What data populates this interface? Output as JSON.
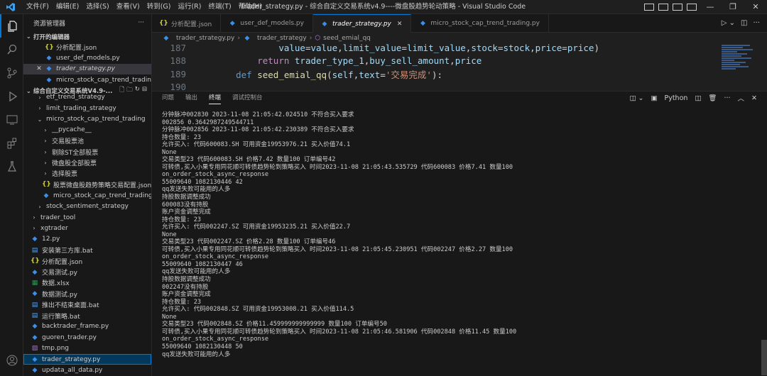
{
  "menu": [
    "文件(F)",
    "编辑(E)",
    "选择(S)",
    "查看(V)",
    "转到(G)",
    "运行(R)",
    "终端(T)",
    "帮助(H)"
  ],
  "window_title": "trader_strategy.py - 综合自定义交易系统v4.9----微盘股趋势轮动策略 - Visual Studio Code",
  "sidebar": {
    "title": "资源管理器",
    "open_editors_label": "打开的编辑器",
    "open_editors": [
      {
        "name": "分析配置.json",
        "icon": "json"
      },
      {
        "name": "user_def_models.py",
        "icon": "py"
      },
      {
        "name": "trader_strategy.py",
        "icon": "py"
      },
      {
        "name": "micro_stock_cap_trend_trading....",
        "icon": "py"
      }
    ],
    "workspace_label": "综合自定义交易系统V4.9-...",
    "tree": [
      {
        "name": "etf_trend_strategy",
        "indent": 1,
        "chev": "›"
      },
      {
        "name": "limit_trading_strategy",
        "indent": 1,
        "chev": "›"
      },
      {
        "name": "micro_stock_cap_trend_trading",
        "indent": 1,
        "chev": "⌄"
      },
      {
        "name": "__pycache__",
        "indent": 2,
        "chev": "›"
      },
      {
        "name": "交易股票池",
        "indent": 2,
        "chev": "›"
      },
      {
        "name": "剔除ST全部股票",
        "indent": 2,
        "chev": "›"
      },
      {
        "name": "微盘股全部股票",
        "indent": 2,
        "chev": "›"
      },
      {
        "name": "选择股票",
        "indent": 2,
        "chev": "›"
      },
      {
        "name": "股票微盘股趋势策略交易配置.json",
        "indent": 2,
        "icon": "json"
      },
      {
        "name": "micro_stock_cap_trend_trading.py",
        "indent": 2,
        "icon": "py"
      },
      {
        "name": "stock_sentiment_strategy",
        "indent": 1,
        "chev": "›"
      },
      {
        "name": "trader_tool",
        "indent": 0,
        "chev": "›"
      },
      {
        "name": "xgtrader",
        "indent": 0,
        "chev": "›"
      },
      {
        "name": "12.py",
        "indent": 0,
        "icon": "py"
      },
      {
        "name": "安装第三方库.bat",
        "indent": 0,
        "icon": "bat"
      },
      {
        "name": "分析配置.json",
        "indent": 0,
        "icon": "json"
      },
      {
        "name": "交易测试.py",
        "indent": 0,
        "icon": "py"
      },
      {
        "name": "数据.xlsx",
        "indent": 0,
        "icon": "xls"
      },
      {
        "name": "数据测试.py",
        "indent": 0,
        "icon": "py"
      },
      {
        "name": "推出不结束桌面.bat",
        "indent": 0,
        "icon": "bat"
      },
      {
        "name": "运行策略.bat",
        "indent": 0,
        "icon": "bat"
      },
      {
        "name": "backtrader_frame.py",
        "indent": 0,
        "icon": "py"
      },
      {
        "name": "guoren_trader.py",
        "indent": 0,
        "icon": "py"
      },
      {
        "name": "tmp.png",
        "indent": 0,
        "icon": "png"
      },
      {
        "name": "trader_strategy.py",
        "indent": 0,
        "icon": "py",
        "focus": true
      },
      {
        "name": "updata_all_data.py",
        "indent": 0,
        "icon": "py"
      }
    ]
  },
  "tabs": [
    {
      "label": "分析配置.json",
      "icon": "json"
    },
    {
      "label": "user_def_models.py",
      "icon": "py"
    },
    {
      "label": "trader_strategy.py",
      "icon": "py",
      "active": true
    },
    {
      "label": "micro_stock_cap_trend_trading.py",
      "icon": "py"
    }
  ],
  "breadcrumb": [
    "trader_strategy.py",
    "trader_strategy",
    "seed_emial_qq"
  ],
  "code_lines": [
    {
      "num": "187",
      "text": "            value=value,limit_value=limit_value,stock=stock,price=price)"
    },
    {
      "num": "188",
      "text": "        return trader_type_1,buy_sell_amount,price"
    },
    {
      "num": "189",
      "text": "    def seed_emial_qq(self,text='交易完成'):"
    },
    {
      "num": "190",
      "text": ""
    }
  ],
  "panel": {
    "tabs": [
      "问题",
      "输出",
      "终端",
      "调试控制台"
    ],
    "active_tab": "终端",
    "terminal_type": "Python",
    "lines": [
      "分钟脉冲002830 2023-11-08 21:05:42.024510 不符合买入要求",
      "002856 0.3642987249544711",
      "分钟脉冲002856 2023-11-08 21:05:42.230389 不符合买入要求",
      "持仓数量: 23",
      "允许买入: 代码600083.SH 可用资金19953976.21 买入价值74.1",
      "None",
      "交易类型23 代码600083.SH 价格7.42 数量100 订单编号42",
      "可转债,买入小果专用同花顺可转债趋势轮到策略买入 时间2023-11-08 21:05:43.535729 代码600083 价格7.41 数量100",
      "on_order_stock_async_response",
      "55009640 1082130446 42",
      "qq发送失败可能用的人多",
      "持股数据调整成功",
      "600083没有持股",
      "账户资金调整完成",
      "持仓数量: 23",
      "允许买入: 代码002247.SZ 可用资金19953235.21 买入价值22.7",
      "None",
      "交易类型23 代码002247.SZ 价格2.28 数量100 订单编号46",
      "可转债,买入小果专用同花顺可转债趋势轮到策略买入 时间2023-11-08 21:05:45.230951 代码002247 价格2.27 数量100",
      "on_order_stock_async_response",
      "55009640 1082130447 46",
      "qq发送失败可能用的人多",
      "持股数据调整成功",
      "002247没有持股",
      "账户资金调整完成",
      "持仓数量: 23",
      "允许买入: 代码002848.SZ 可用资金19953008.21 买入价值114.5",
      "None",
      "交易类型23 代码002848.SZ 价格11.459999999999999 数量100 订单编号50",
      "可转债,买入小果专用同花顺可转债趋势轮到策略买入 时间2023-11-08 21:05:46.581906 代码002848 价格11.45 数量100",
      "on_order_stock_async_response",
      "55009640 1082130448 50",
      "qq发送失败可能用的人多"
    ]
  }
}
